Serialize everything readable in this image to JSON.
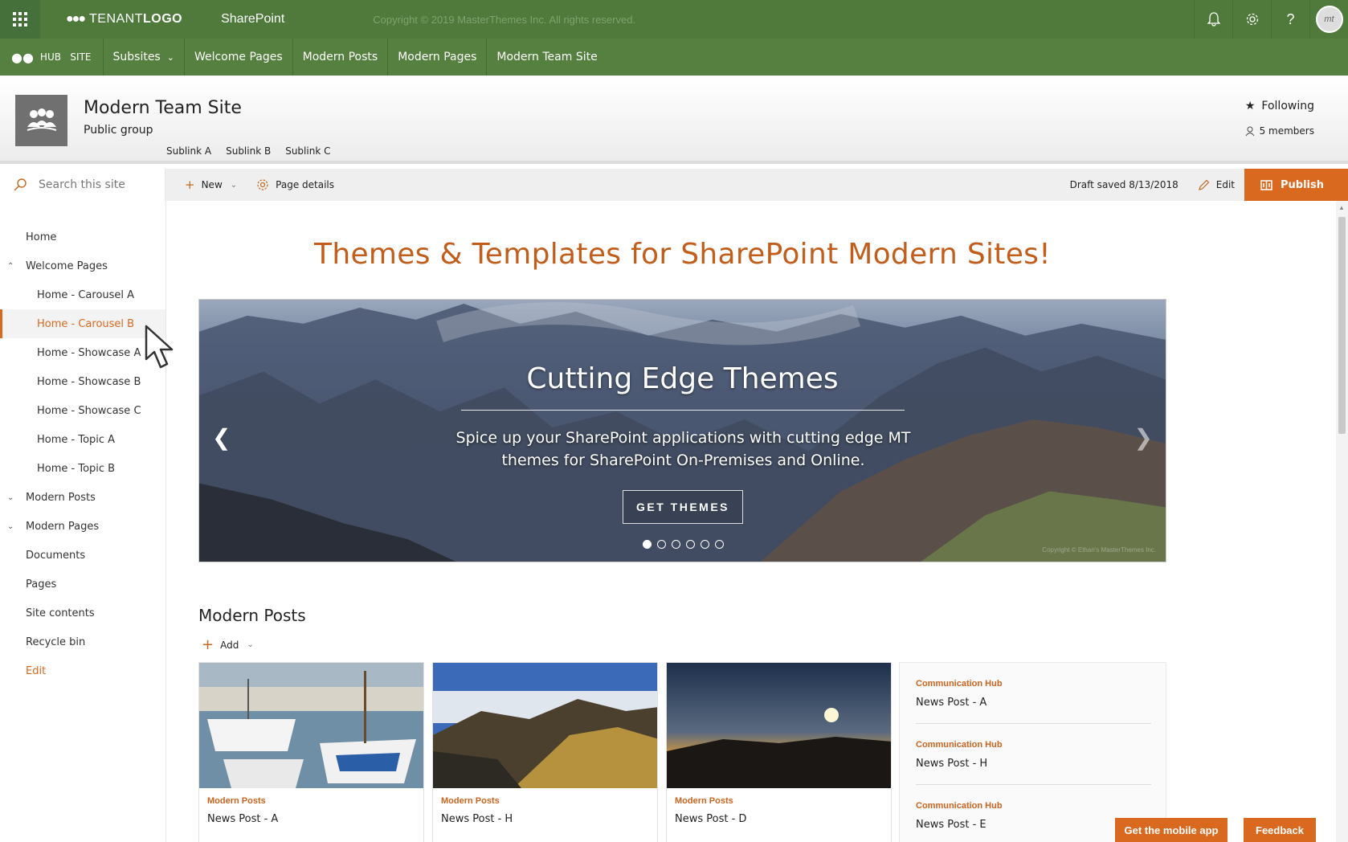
{
  "suitebar": {
    "tenant_logo_light": "TENANT",
    "tenant_logo_bold": "LOGO",
    "app_name": "SharePoint",
    "copyright": "Copyright © 2019 MasterThemes Inc. All rights reserved.",
    "avatar_initials": "mt"
  },
  "hubnav": {
    "brand_a": "HUB",
    "brand_b": "SITE",
    "items": [
      {
        "label": "Subsites"
      },
      {
        "label": "Welcome Pages"
      },
      {
        "label": "Modern Posts"
      },
      {
        "label": "Modern Pages"
      },
      {
        "label": "Modern Team Site"
      }
    ]
  },
  "site": {
    "title": "Modern Team Site",
    "subtitle": "Public group",
    "sublinks": [
      "Sublink A",
      "Sublink B",
      "Sublink C"
    ],
    "following": "Following",
    "members": "5 members"
  },
  "search": {
    "placeholder": "Search this site"
  },
  "commandbar": {
    "new": "New",
    "page_details": "Page details",
    "draft_status": "Draft saved 8/13/2018",
    "edit": "Edit",
    "publish": "Publish"
  },
  "leftnav": {
    "items": [
      {
        "label": "Home"
      },
      {
        "label": "Welcome Pages"
      },
      {
        "label": "Home - Carousel A"
      },
      {
        "label": "Home - Carousel B"
      },
      {
        "label": "Home - Showcase A"
      },
      {
        "label": "Home - Showcase B"
      },
      {
        "label": "Home - Showcase C"
      },
      {
        "label": "Home - Topic A"
      },
      {
        "label": "Home - Topic B"
      },
      {
        "label": "Modern Posts"
      },
      {
        "label": "Modern Pages"
      },
      {
        "label": "Documents"
      },
      {
        "label": "Pages"
      },
      {
        "label": "Site contents"
      },
      {
        "label": "Recycle bin"
      },
      {
        "label": "Edit"
      }
    ]
  },
  "page": {
    "title": "Themes & Templates for SharePoint Modern Sites!"
  },
  "carousel": {
    "title": "Cutting Edge Themes",
    "text": "Spice up your SharePoint applications with cutting edge MT themes for SharePoint On-Premises and Online.",
    "button": "GET THEMES",
    "copyright": "Copyright © Ethan's MasterThemes Inc.",
    "slide_count": 6,
    "active_slide": 1
  },
  "news": {
    "section_title": "Modern Posts",
    "add_label": "Add",
    "cards": [
      {
        "category": "Modern Posts",
        "title": "News Post - A"
      },
      {
        "category": "Modern Posts",
        "title": "News Post - H"
      },
      {
        "category": "Modern Posts",
        "title": "News Post - D"
      }
    ],
    "list": [
      {
        "category": "Communication Hub",
        "title": "News Post - A"
      },
      {
        "category": "Communication Hub",
        "title": "News Post - H"
      },
      {
        "category": "Communication Hub",
        "title": "News Post - E"
      }
    ]
  },
  "footer": {
    "mobile_app": "Get the mobile app",
    "feedback": "Feedback"
  },
  "colors": {
    "suitebar": "#4f7a3b",
    "hubnav": "#55803f",
    "accent": "#d9691f",
    "title": "#c25e1c"
  }
}
